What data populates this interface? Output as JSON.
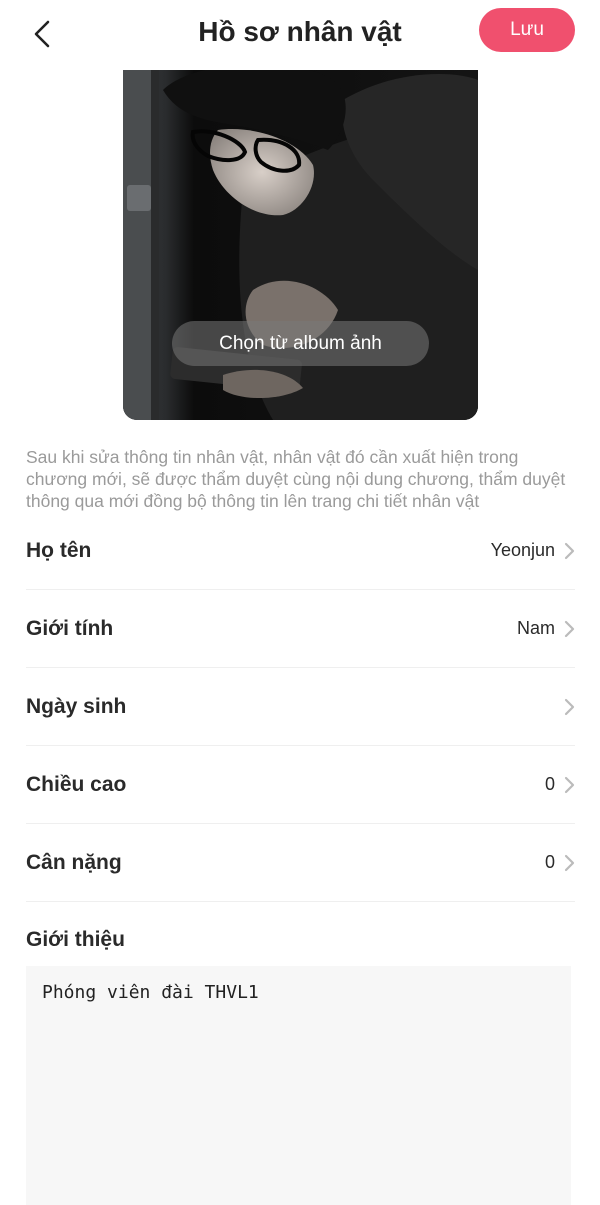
{
  "header": {
    "title": "Hồ sơ nhân vật",
    "save_label": "Lưu"
  },
  "avatar": {
    "album_button_label": "Chọn từ album ảnh"
  },
  "notice": "Sau khi sửa thông tin nhân vật, nhân vật đó cần xuất hiện trong chương mới, sẽ được thẩm duyệt cùng nội dung chương, thẩm duyệt thông qua mới đồng bộ thông tin lên trang chi tiết nhân vật",
  "fields": [
    {
      "label": "Họ tên",
      "value": "Yeonjun"
    },
    {
      "label": "Giới tính",
      "value": "Nam"
    },
    {
      "label": "Ngày sinh",
      "value": ""
    },
    {
      "label": "Chiều cao",
      "value": "0"
    },
    {
      "label": "Cân nặng",
      "value": "0"
    }
  ],
  "intro": {
    "label": "Giới thiệu",
    "text": "Phóng viên đài THVL1"
  },
  "colors": {
    "accent": "#f0506e",
    "muted_text": "#9a9a9a",
    "input_bg": "#f7f7f7"
  }
}
